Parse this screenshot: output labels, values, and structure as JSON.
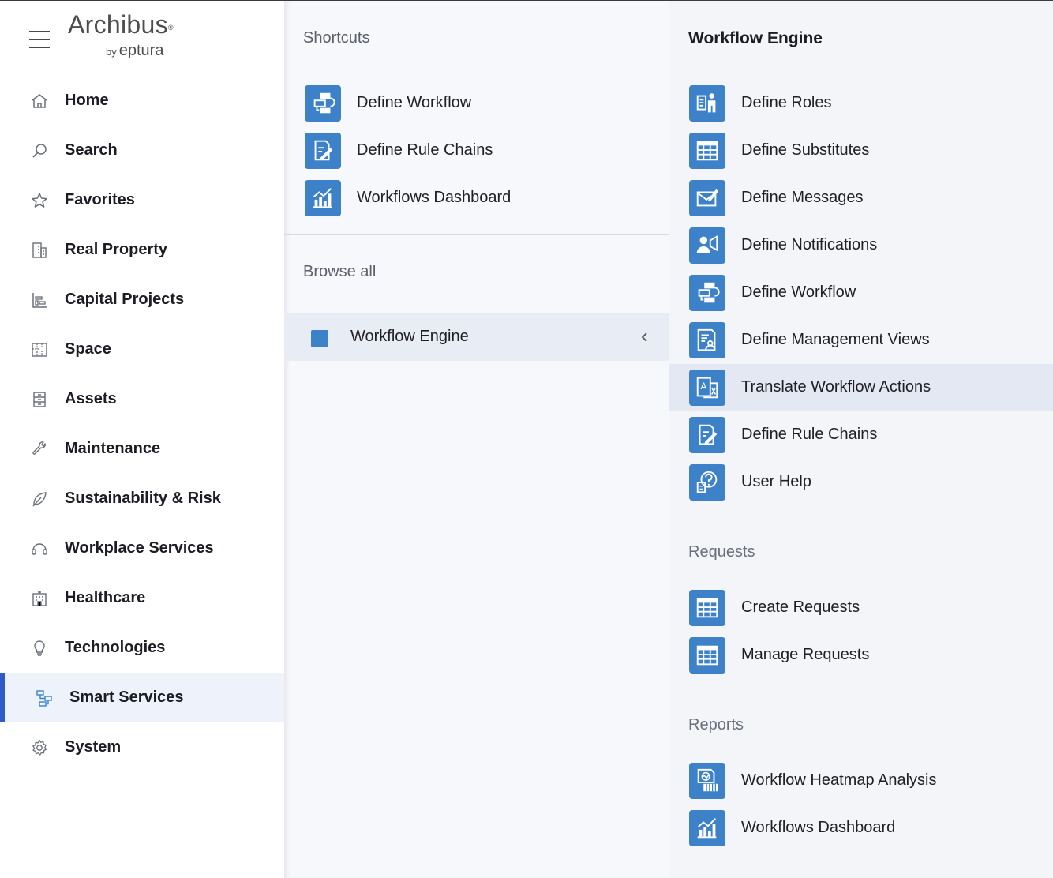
{
  "app": {
    "logo_main": "Archibus",
    "logo_by": "by",
    "logo_brand": "eptura"
  },
  "sidebar": {
    "items": [
      {
        "label": "Home",
        "icon": "home-icon",
        "has_chevron": false
      },
      {
        "label": "Search",
        "icon": "search-icon",
        "has_chevron": true
      },
      {
        "label": "Favorites",
        "icon": "star-icon",
        "has_chevron": true
      },
      {
        "label": "Real Property",
        "icon": "building-icon",
        "has_chevron": true
      },
      {
        "label": "Capital Projects",
        "icon": "bar-chart-icon",
        "has_chevron": true
      },
      {
        "label": "Space",
        "icon": "floorplan-icon",
        "has_chevron": true
      },
      {
        "label": "Assets",
        "icon": "cabinet-icon",
        "has_chevron": true
      },
      {
        "label": "Maintenance",
        "icon": "wrench-icon",
        "has_chevron": true
      },
      {
        "label": "Sustainability & Risk",
        "icon": "leaf-icon",
        "has_chevron": true
      },
      {
        "label": "Workplace Services",
        "icon": "headset-icon",
        "has_chevron": true
      },
      {
        "label": "Healthcare",
        "icon": "hospital-icon",
        "has_chevron": true
      },
      {
        "label": "Technologies",
        "icon": "lightbulb-icon",
        "has_chevron": true
      },
      {
        "label": "Smart Services",
        "icon": "workflow-icon",
        "has_chevron": true,
        "active": true
      },
      {
        "label": "System",
        "icon": "gear-icon",
        "has_chevron": true
      }
    ]
  },
  "middle": {
    "shortcuts_title": "Shortcuts",
    "shortcuts": [
      {
        "label": "Define Workflow",
        "icon": "workflow-diagram-icon"
      },
      {
        "label": "Define Rule Chains",
        "icon": "edit-document-icon"
      },
      {
        "label": "Workflows Dashboard",
        "icon": "dashboard-chart-icon"
      }
    ],
    "browse_title": "Browse all",
    "browse_item": "Workflow Engine"
  },
  "right": {
    "title": "Workflow Engine",
    "items": [
      {
        "label": "Define Roles",
        "icon": "roles-icon"
      },
      {
        "label": "Define Substitutes",
        "icon": "table-icon"
      },
      {
        "label": "Define Messages",
        "icon": "envelope-edit-icon"
      },
      {
        "label": "Define Notifications",
        "icon": "user-notification-icon"
      },
      {
        "label": "Define Workflow",
        "icon": "workflow-diagram-icon"
      },
      {
        "label": "Define Management Views",
        "icon": "document-user-icon"
      },
      {
        "label": "Translate Workflow Actions",
        "icon": "translate-icon",
        "highlighted": true
      },
      {
        "label": "Define Rule Chains",
        "icon": "edit-document-icon"
      },
      {
        "label": "User Help",
        "icon": "help-icon"
      }
    ],
    "requests_title": "Requests",
    "requests": [
      {
        "label": "Create Requests",
        "icon": "table-icon"
      },
      {
        "label": "Manage Requests",
        "icon": "table-icon"
      }
    ],
    "reports_title": "Reports",
    "reports": [
      {
        "label": "Workflow Heatmap Analysis",
        "icon": "heatmap-report-icon"
      },
      {
        "label": "Workflows Dashboard",
        "icon": "dashboard-chart-icon"
      }
    ]
  },
  "colors": {
    "accent": "#2f5bc9",
    "icon_tile": "#3d82c9",
    "active_bg": "#eef2fa",
    "panel_bg": "#f7f8fb",
    "right_bg": "#f3f5f9"
  }
}
